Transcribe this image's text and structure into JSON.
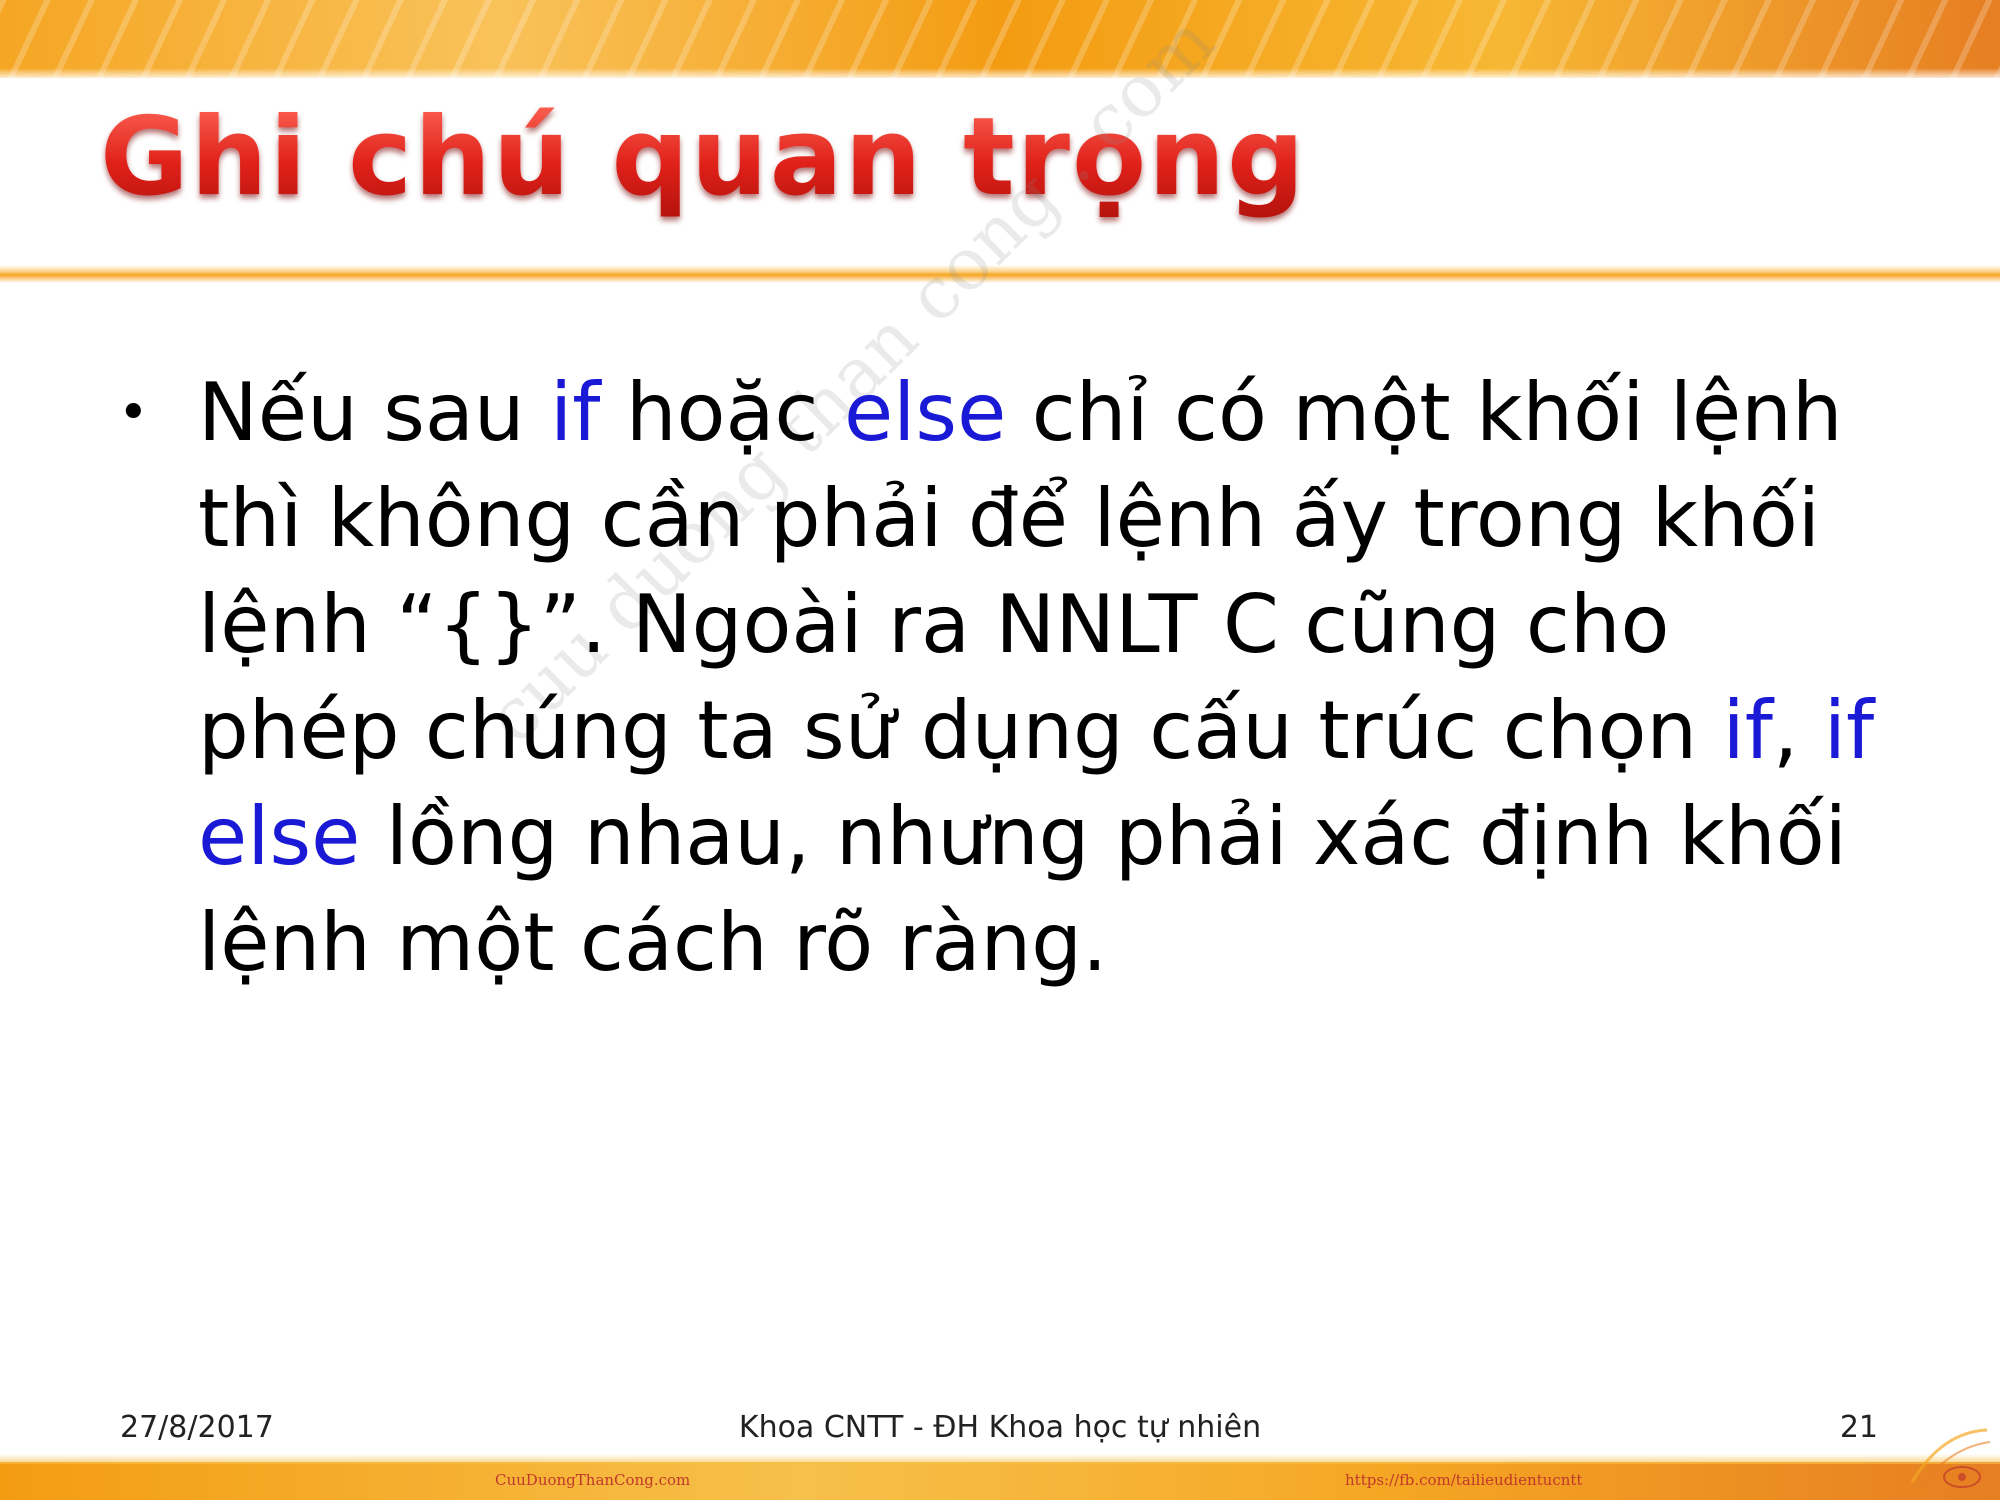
{
  "slide": {
    "title": "Ghi chú quan trọng",
    "body": {
      "s1": "Nếu sau ",
      "kw1": "if",
      "s2": " hoặc ",
      "kw2": "else",
      "s3": " chỉ có một khối lệnh thì không cần phải để lệnh ấy trong khối lệnh “{}”. Ngoài ra NNLT C cũng cho phép chúng ta sử dụng cấu trúc chọn ",
      "kw3": "if",
      "s4": ", ",
      "kw4": "if else",
      "s5": " lồng nhau, nhưng phải xác định khối lệnh một cách rõ ràng."
    },
    "keyword_color": "#1a1ad6",
    "title_color": "#e0211a"
  },
  "watermark": "cuu duong than cong . com",
  "footer": {
    "date": "27/8/2017",
    "center": "Khoa CNTT - ĐH Khoa học tự nhiên",
    "page": "21",
    "link_left": "CuuDuongThanCong.com",
    "link_right": "https://fb.com/tailieudientucntt"
  }
}
